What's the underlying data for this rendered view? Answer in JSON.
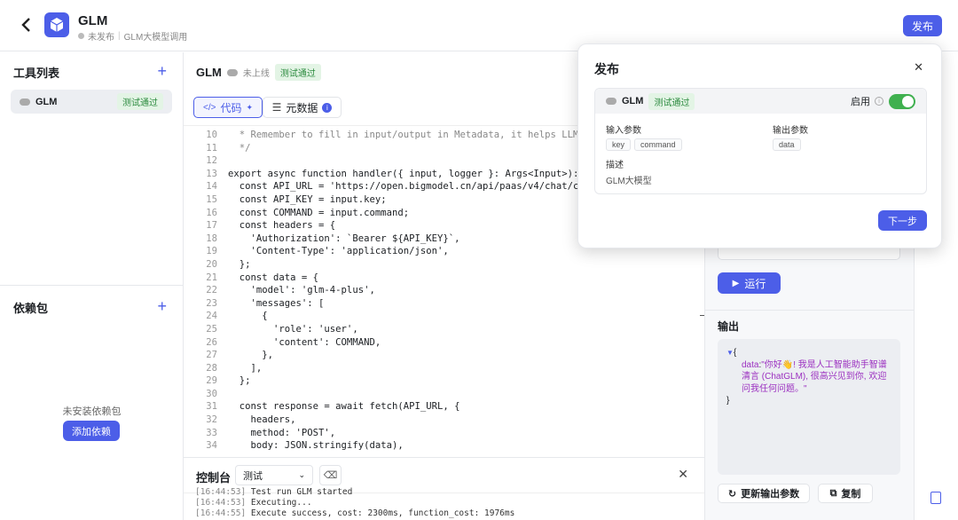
{
  "header": {
    "title": "GLM",
    "status": "未发布",
    "subtitle": "GLM大模型调用",
    "publish_label": "发布"
  },
  "left": {
    "tools_title": "工具列表",
    "tool_item": {
      "name": "GLM",
      "badge": "测试通过"
    },
    "deps_title": "依赖包",
    "deps_empty": "未安装依赖包",
    "add_dep_label": "添加依赖"
  },
  "editor": {
    "title": "GLM",
    "status": "未上线",
    "badge": "测试通过",
    "tab_code": "代码",
    "tab_meta": "元数据"
  },
  "code_lines": [
    {
      "n": "10",
      "t": "  * Remember to fill in input/output in Metadata, it helps LLM to rec"
    },
    {
      "n": "11",
      "t": "  */"
    },
    {
      "n": "12",
      "t": ""
    },
    {
      "n": "13",
      "t": "export async function handler({ input, logger }: Args<Input>): Promis"
    },
    {
      "n": "14",
      "t": "  const API_URL = 'https://open.bigmodel.cn/api/paas/v4/chat/completi"
    },
    {
      "n": "15",
      "t": "  const API_KEY = input.key;"
    },
    {
      "n": "16",
      "t": "  const COMMAND = input.command;"
    },
    {
      "n": "17",
      "t": "  const headers = {"
    },
    {
      "n": "18",
      "t": "    'Authorization': `Bearer ${API_KEY}`,"
    },
    {
      "n": "19",
      "t": "    'Content-Type': 'application/json',"
    },
    {
      "n": "20",
      "t": "  };"
    },
    {
      "n": "21",
      "t": "  const data = {"
    },
    {
      "n": "22",
      "t": "    'model': 'glm-4-plus',"
    },
    {
      "n": "23",
      "t": "    'messages': ["
    },
    {
      "n": "24",
      "t": "      {"
    },
    {
      "n": "25",
      "t": "        'role': 'user',"
    },
    {
      "n": "26",
      "t": "        'content': COMMAND,"
    },
    {
      "n": "27",
      "t": "      },"
    },
    {
      "n": "28",
      "t": "    ],"
    },
    {
      "n": "29",
      "t": "  };"
    },
    {
      "n": "30",
      "t": ""
    },
    {
      "n": "31",
      "t": "  const response = await fetch(API_URL, {"
    },
    {
      "n": "32",
      "t": "    headers,"
    },
    {
      "n": "33",
      "t": "    method: 'POST',"
    },
    {
      "n": "34",
      "t": "    body: JSON.stringify(data),"
    }
  ],
  "console": {
    "title": "控制台",
    "select_value": "测试",
    "logs": [
      {
        "time": "[16:44:53]",
        "msg": " Test run GLM started"
      },
      {
        "time": "[16:44:53]",
        "msg": " Executing..."
      },
      {
        "time": "[16:44:55]",
        "msg": " Execute success, cost: 2300ms, function_cost: 1976ms"
      }
    ]
  },
  "right": {
    "run_label": "运行",
    "output_title": "输出",
    "output_key": "data",
    "output_value": "\"你好👋! 我是人工智能助手智谱清言 (ChatGLM), 很高兴见到你, 欢迎问我任何问题。\"",
    "update_label": "更新输出参数",
    "copy_label": "复制"
  },
  "modal": {
    "title": "发布",
    "tool_name": "GLM",
    "badge": "测试通过",
    "enable_label": "启用",
    "enabled": true,
    "input_title": "输入参数",
    "inputs": [
      "key",
      "command"
    ],
    "output_title": "输出参数",
    "outputs": [
      "data"
    ],
    "desc_title": "描述",
    "desc": "GLM大模型",
    "next_label": "下一步"
  },
  "colors": {
    "accent": "#4c5ee8",
    "success": "#3fb04f"
  }
}
